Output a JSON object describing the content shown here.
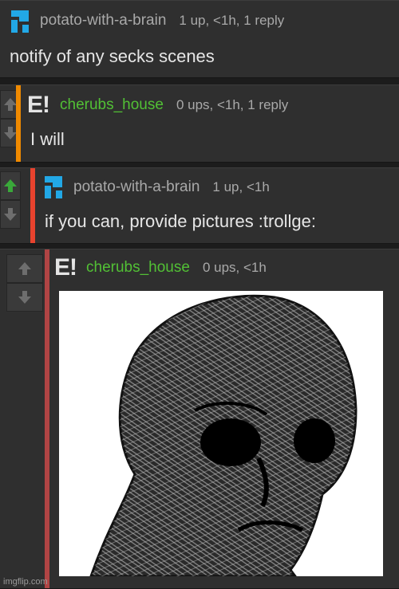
{
  "comments": [
    {
      "user": "potato-with-a-brain",
      "meta": "1 up, <1h, 1 reply",
      "text": "notify of any secks scenes",
      "avatar": "blue-block-avatar-icon"
    },
    {
      "user": "cherubs_house",
      "meta": "0 ups, <1h, 1 reply",
      "text": "I will",
      "avatar": "e-exclamation-avatar-icon",
      "bar_color": "#f08a00"
    },
    {
      "user": "potato-with-a-brain",
      "meta": "1 up, <1h",
      "text": "if you can, provide pictures :trollge:",
      "avatar": "blue-block-avatar-icon",
      "bar_color": "#e8432e",
      "upvoted": true
    },
    {
      "user": "cherubs_house",
      "meta": "0 ups, <1h",
      "avatar": "e-exclamation-avatar-icon",
      "bar_color": "#b04444",
      "image": "wojak-scribble-face-image"
    }
  ],
  "colors": {
    "username_green": "#52c035",
    "upvote_green": "#3aa83a",
    "avatar_blue": "#22a8e6"
  },
  "watermark": "imgflip.com"
}
